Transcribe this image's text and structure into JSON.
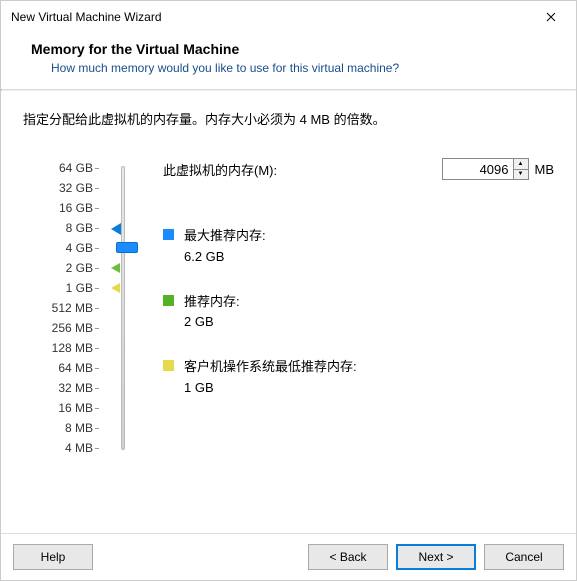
{
  "window": {
    "title": "New Virtual Machine Wizard"
  },
  "header": {
    "title": "Memory for the Virtual Machine",
    "subtitle": "How much memory would you like to use for this virtual machine?"
  },
  "instruction": "指定分配给此虚拟机的内存量。内存大小必须为 4 MB 的倍数。",
  "memory": {
    "label": "此虚拟机的内存(M):",
    "value": "4096",
    "unit": "MB",
    "scale": [
      "64 GB",
      "32 GB",
      "16 GB",
      "8 GB",
      "4 GB",
      "2 GB",
      "1 GB",
      "512 MB",
      "256 MB",
      "128 MB",
      "64 MB",
      "32 MB",
      "16 MB",
      "8 MB",
      "4 MB"
    ]
  },
  "legend": {
    "max": {
      "label": "最大推荐内存:",
      "value": "6.2 GB"
    },
    "rec": {
      "label": "推荐内存:",
      "value": "2 GB"
    },
    "min": {
      "label": "客户机操作系统最低推荐内存:",
      "value": "1 GB"
    }
  },
  "buttons": {
    "help": "Help",
    "back": "< Back",
    "next": "Next >",
    "cancel": "Cancel"
  }
}
